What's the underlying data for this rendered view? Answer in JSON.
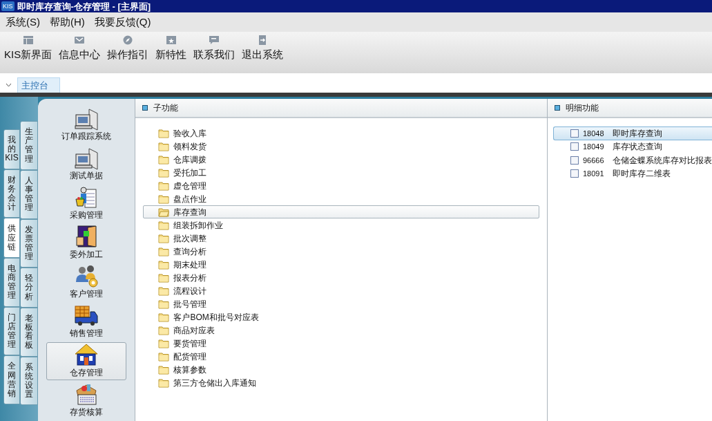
{
  "window": {
    "logo": "KIS",
    "title": "即时库存查询-仓存管理 - [主界面]"
  },
  "menu": [
    "系统(S)",
    "帮助(H)",
    "我要反馈(Q)"
  ],
  "toolbar": [
    {
      "label": "KIS新界面",
      "kind": "layout"
    },
    {
      "label": "信息中心",
      "kind": "mail"
    },
    {
      "label": "操作指引",
      "kind": "compass"
    },
    {
      "label": "新特性",
      "kind": "star"
    },
    {
      "label": "联系我们",
      "kind": "chat"
    },
    {
      "label": "退出系统",
      "kind": "exit"
    }
  ],
  "doc_tabs": [
    {
      "label": "主控台",
      "selected": true
    }
  ],
  "side_tabs_outer": [
    {
      "label": "我的KIS",
      "selected": false
    },
    {
      "label": "财务会计",
      "selected": false
    },
    {
      "label": "供应链",
      "selected": true
    },
    {
      "label": "电商管理",
      "selected": false
    },
    {
      "label": "门店管理",
      "selected": false
    },
    {
      "label": "全网营销",
      "selected": false
    }
  ],
  "side_tabs_inner": [
    "生产管理",
    "人事管理",
    "发票管理",
    "轻分析",
    "老板看板",
    "系统设置"
  ],
  "modules": [
    {
      "label": "订单跟踪系统",
      "kind": "computer",
      "selected": false
    },
    {
      "label": "测试单据",
      "kind": "computer",
      "selected": false
    },
    {
      "label": "采购管理",
      "kind": "buyer",
      "selected": false
    },
    {
      "label": "委外加工",
      "kind": "door",
      "selected": false
    },
    {
      "label": "客户管理",
      "kind": "people",
      "selected": false
    },
    {
      "label": "销售管理",
      "kind": "truck",
      "selected": false
    },
    {
      "label": "仓存管理",
      "kind": "house",
      "selected": true
    },
    {
      "label": "存货核算",
      "kind": "calculator",
      "selected": false
    }
  ],
  "sub_functions": {
    "title": "子功能",
    "items": [
      {
        "label": "验收入库",
        "selected": false
      },
      {
        "label": "领料发货",
        "selected": false
      },
      {
        "label": "仓库调拨",
        "selected": false
      },
      {
        "label": "受托加工",
        "selected": false
      },
      {
        "label": "虚仓管理",
        "selected": false
      },
      {
        "label": "盘点作业",
        "selected": false
      },
      {
        "label": "库存查询",
        "selected": true
      },
      {
        "label": "组装拆卸作业",
        "selected": false
      },
      {
        "label": "批次调整",
        "selected": false
      },
      {
        "label": "查询分析",
        "selected": false
      },
      {
        "label": "期末处理",
        "selected": false
      },
      {
        "label": "报表分析",
        "selected": false
      },
      {
        "label": "流程设计",
        "selected": false
      },
      {
        "label": "批号管理",
        "selected": false
      },
      {
        "label": "客户BOM和批号对应表",
        "selected": false
      },
      {
        "label": "商品对应表",
        "selected": false
      },
      {
        "label": "要货管理",
        "selected": false
      },
      {
        "label": "配货管理",
        "selected": false
      },
      {
        "label": "核算参数",
        "selected": false
      },
      {
        "label": "第三方仓储出入库通知",
        "selected": false
      }
    ]
  },
  "detail_functions": {
    "title": "明细功能",
    "items": [
      {
        "code": "18048",
        "label": "即时库存查询",
        "selected": true
      },
      {
        "code": "18049",
        "label": "库存状态查询",
        "selected": false
      },
      {
        "code": "96666",
        "label": "仓储金蝶系统库存对比报表",
        "selected": false
      },
      {
        "code": "18091",
        "label": "即时库存二维表",
        "selected": false
      }
    ]
  }
}
